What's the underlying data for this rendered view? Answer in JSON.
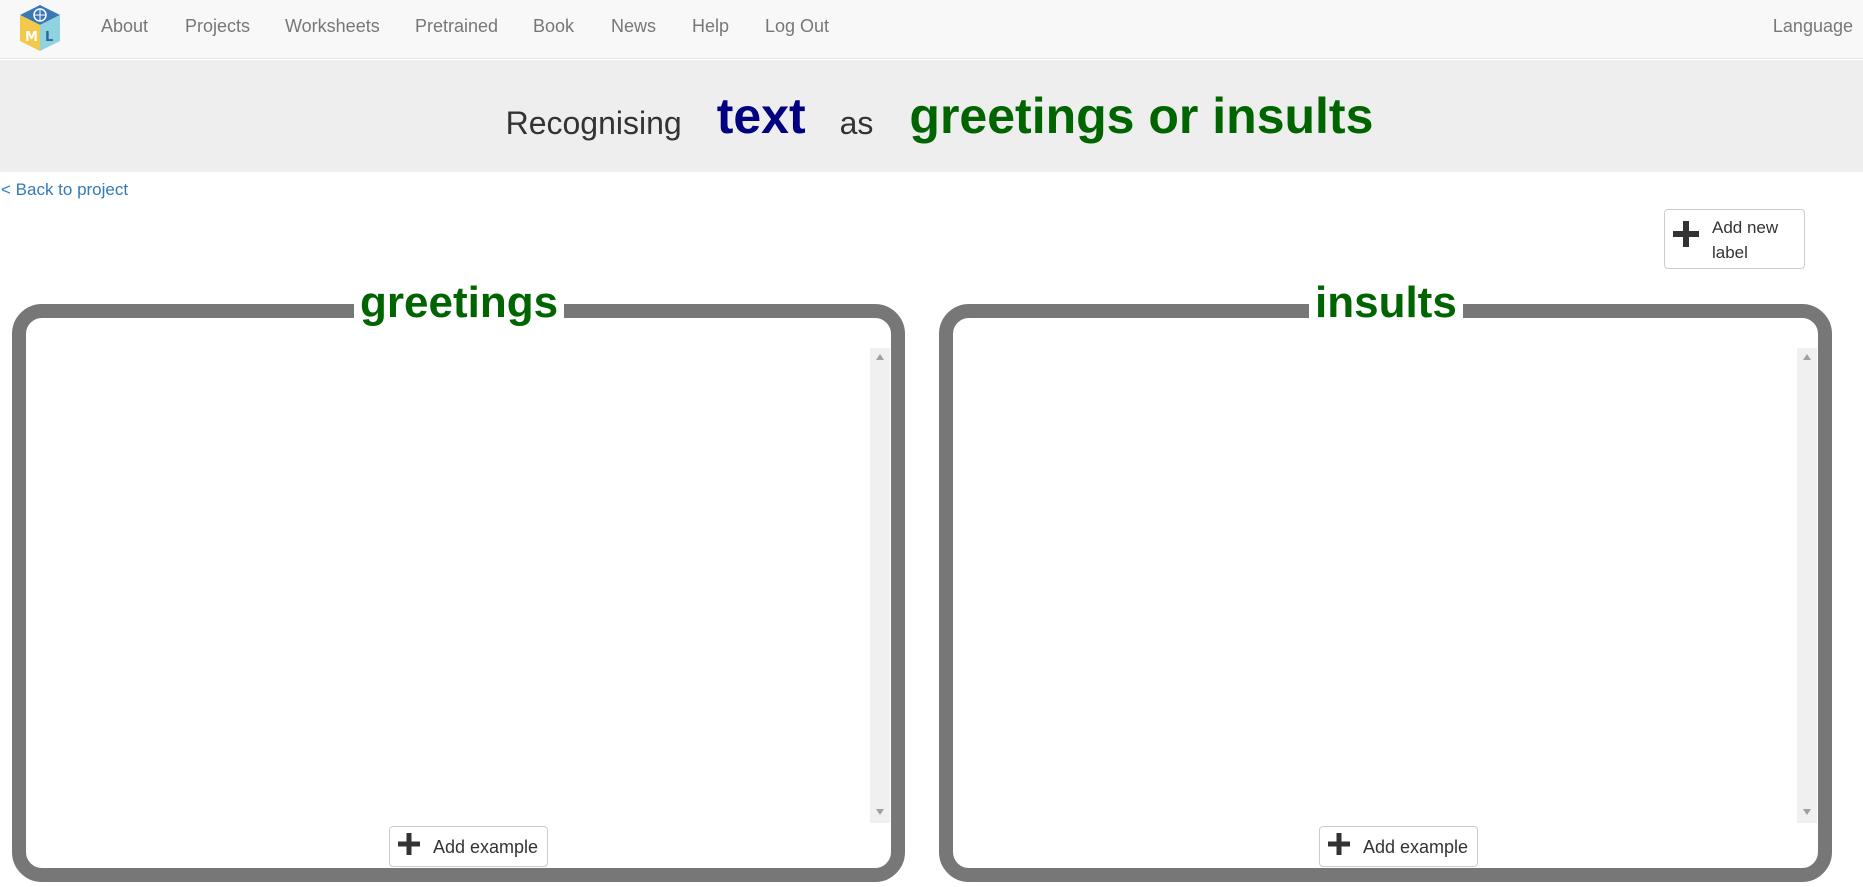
{
  "nav": {
    "items": [
      "About",
      "Projects",
      "Worksheets",
      "Pretrained",
      "Book",
      "News",
      "Help",
      "Log Out"
    ],
    "language": "Language",
    "logo_letters": [
      "M",
      "L"
    ]
  },
  "banner": {
    "recognising": "Recognising",
    "type": "text",
    "as": "as",
    "labels": "greetings or insults"
  },
  "back_link": "< Back to project",
  "add_label_button": "Add new label",
  "buckets": [
    {
      "label": "greetings",
      "add_example": "Add example"
    },
    {
      "label": "insults",
      "add_example": "Add example"
    }
  ],
  "colors": {
    "label_green": "#006400",
    "type_navy": "#000080",
    "link_blue": "#337ab7",
    "bucket_border": "#777777"
  }
}
